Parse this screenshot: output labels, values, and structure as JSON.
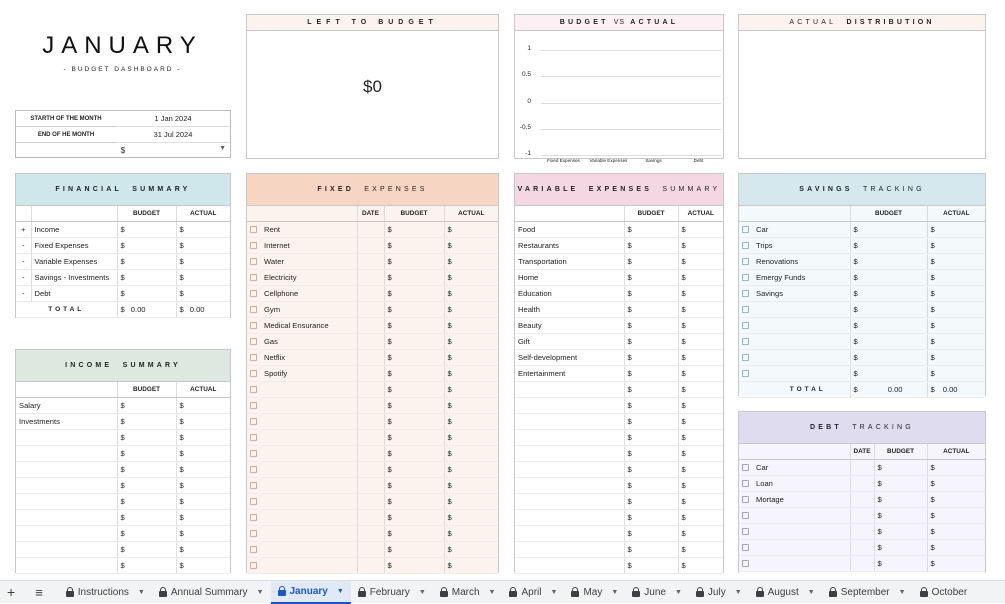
{
  "title": "JANUARY",
  "subtitle": "- BUDGET DASHBOARD -",
  "period": {
    "start_label": "STARTH OF THE MONTH",
    "start_value": "1 Jan 2024",
    "end_label": "END OF HE MONTH",
    "end_value": "31 Jul 2024",
    "currency": "$"
  },
  "left_to_budget": {
    "title": "LEFT TO BUDGET",
    "value": "$0"
  },
  "budget_vs_actual": {
    "title_a": "BUDGET",
    "title_b": "VS",
    "title_c": "ACTUAL"
  },
  "actual_distribution": {
    "title_a": "ACTUAL",
    "title_b": "DISTRIBUTION"
  },
  "chart_data": {
    "type": "bar",
    "categories": [
      "Fixed Expenses",
      "Variable Expenses",
      "Savings",
      "Debt"
    ],
    "series": [
      {
        "values": [
          0,
          0,
          0,
          0
        ]
      },
      {
        "values": [
          0,
          0,
          0,
          0
        ]
      }
    ],
    "yticks": [
      "1",
      "0.5",
      "0",
      "-0.5",
      "-1"
    ],
    "ylim": [
      -1,
      1
    ],
    "grid": true
  },
  "colors": {
    "financial": "#cfe6ea",
    "income": "#dde9e0",
    "fixed": "#f6d6c2",
    "fixed_row": "#fdf3ee",
    "variable": "#f3d7e2",
    "savings": "#d4e8ee",
    "debt": "#e0dcf0",
    "period": "#e7e4f5",
    "active_tab": "#1a56c5"
  },
  "financial_summary": {
    "title_a": "FINANCIAL",
    "title_b": "SUMMARY",
    "col_budget": "BUDGET",
    "col_actual": "ACTUAL",
    "rows": [
      {
        "sign": "+",
        "label": "Income",
        "b": "$",
        "a": "$"
      },
      {
        "sign": "-",
        "label": "Fixed Expenses",
        "b": "$",
        "a": "$"
      },
      {
        "sign": "-",
        "label": "Variable Expenses",
        "b": "$",
        "a": "$"
      },
      {
        "sign": "-",
        "label": "Savings - Investments",
        "b": "$",
        "a": "$"
      },
      {
        "sign": "-",
        "label": "Debt",
        "b": "$",
        "a": "$"
      }
    ],
    "total_label": "TOTAL",
    "total_b_cur": "$",
    "total_b": "0.00",
    "total_a_cur": "$",
    "total_a": "0.00"
  },
  "income_summary": {
    "title_a": "INCOME",
    "title_b": "SUMMARY",
    "col_budget": "BUDGET",
    "col_actual": "ACTUAL",
    "rows": [
      {
        "label": "Salary",
        "b": "$",
        "a": "$"
      },
      {
        "label": "Investments",
        "b": "$",
        "a": "$"
      },
      {
        "label": "",
        "b": "$",
        "a": "$"
      },
      {
        "label": "",
        "b": "$",
        "a": "$"
      },
      {
        "label": "",
        "b": "$",
        "a": "$"
      },
      {
        "label": "",
        "b": "$",
        "a": "$"
      },
      {
        "label": "",
        "b": "$",
        "a": "$"
      },
      {
        "label": "",
        "b": "$",
        "a": "$"
      },
      {
        "label": "",
        "b": "$",
        "a": "$"
      },
      {
        "label": "",
        "b": "$",
        "a": "$"
      },
      {
        "label": "",
        "b": "$",
        "a": "$"
      }
    ]
  },
  "fixed_expenses": {
    "title_a": "FIXED",
    "title_b": "EXPENSES",
    "col_date": "DATE",
    "col_budget": "BUDGET",
    "col_actual": "ACTUAL",
    "rows": [
      {
        "label": "Rent",
        "b": "$",
        "a": "$"
      },
      {
        "label": "Internet",
        "b": "$",
        "a": "$"
      },
      {
        "label": "Water",
        "b": "$",
        "a": "$"
      },
      {
        "label": "Electricity",
        "b": "$",
        "a": "$"
      },
      {
        "label": "Cellphone",
        "b": "$",
        "a": "$"
      },
      {
        "label": "Gym",
        "b": "$",
        "a": "$"
      },
      {
        "label": "Medical Ensurance",
        "b": "$",
        "a": "$"
      },
      {
        "label": "Gas",
        "b": "$",
        "a": "$"
      },
      {
        "label": "Netflix",
        "b": "$",
        "a": "$"
      },
      {
        "label": "Spotify",
        "b": "$",
        "a": "$"
      },
      {
        "label": "",
        "b": "$",
        "a": "$"
      },
      {
        "label": "",
        "b": "$",
        "a": "$"
      },
      {
        "label": "",
        "b": "$",
        "a": "$"
      },
      {
        "label": "",
        "b": "$",
        "a": "$"
      },
      {
        "label": "",
        "b": "$",
        "a": "$"
      },
      {
        "label": "",
        "b": "$",
        "a": "$"
      },
      {
        "label": "",
        "b": "$",
        "a": "$"
      },
      {
        "label": "",
        "b": "$",
        "a": "$"
      },
      {
        "label": "",
        "b": "$",
        "a": "$"
      },
      {
        "label": "",
        "b": "$",
        "a": "$"
      },
      {
        "label": "",
        "b": "$",
        "a": "$"
      },
      {
        "label": "",
        "b": "$",
        "a": "$"
      }
    ]
  },
  "variable_expenses": {
    "title_a": "VARIABLE",
    "title_b": "EXPENSES",
    "title_c": "SUMMARY",
    "col_budget": "BUDGET",
    "col_actual": "ACTUAL",
    "rows": [
      {
        "label": "Food",
        "b": "$",
        "a": "$"
      },
      {
        "label": "Restaurants",
        "b": "$",
        "a": "$"
      },
      {
        "label": "Transportation",
        "b": "$",
        "a": "$"
      },
      {
        "label": "Home",
        "b": "$",
        "a": "$"
      },
      {
        "label": "Education",
        "b": "$",
        "a": "$"
      },
      {
        "label": "Health",
        "b": "$",
        "a": "$"
      },
      {
        "label": "Beauty",
        "b": "$",
        "a": "$"
      },
      {
        "label": "Gift",
        "b": "$",
        "a": "$"
      },
      {
        "label": "Self-development",
        "b": "$",
        "a": "$"
      },
      {
        "label": "Entertainment",
        "b": "$",
        "a": "$"
      },
      {
        "label": "",
        "b": "$",
        "a": "$"
      },
      {
        "label": "",
        "b": "$",
        "a": "$"
      },
      {
        "label": "",
        "b": "$",
        "a": "$"
      },
      {
        "label": "",
        "b": "$",
        "a": "$"
      },
      {
        "label": "",
        "b": "$",
        "a": "$"
      },
      {
        "label": "",
        "b": "$",
        "a": "$"
      },
      {
        "label": "",
        "b": "$",
        "a": "$"
      },
      {
        "label": "",
        "b": "$",
        "a": "$"
      },
      {
        "label": "",
        "b": "$",
        "a": "$"
      },
      {
        "label": "",
        "b": "$",
        "a": "$"
      },
      {
        "label": "",
        "b": "$",
        "a": "$"
      },
      {
        "label": "",
        "b": "$",
        "a": "$"
      }
    ]
  },
  "savings_tracking": {
    "title_a": "SAVINGS",
    "title_b": "TRACKING",
    "col_budget": "BUDGET",
    "col_actual": "ACTUAL",
    "rows": [
      {
        "label": "Car",
        "b": "$",
        "a": "$"
      },
      {
        "label": "Trips",
        "b": "$",
        "a": "$"
      },
      {
        "label": "Renovations",
        "b": "$",
        "a": "$"
      },
      {
        "label": "Emergy Funds",
        "b": "$",
        "a": "$"
      },
      {
        "label": "Savings",
        "b": "$",
        "a": "$"
      },
      {
        "label": "",
        "b": "$",
        "a": "$"
      },
      {
        "label": "",
        "b": "$",
        "a": "$"
      },
      {
        "label": "",
        "b": "$",
        "a": "$"
      },
      {
        "label": "",
        "b": "$",
        "a": "$"
      },
      {
        "label": "",
        "b": "$",
        "a": "$"
      }
    ],
    "total_label": "TOTAL",
    "total_b_cur": "$",
    "total_b": "0.00",
    "total_a_cur": "$",
    "total_a": "0.00"
  },
  "debt_tracking": {
    "title_a": "DEBT",
    "title_b": "TRACKING",
    "col_date": "DATE",
    "col_budget": "BUDGET",
    "col_actual": "ACTUAL",
    "rows": [
      {
        "label": "Car",
        "b": "$",
        "a": "$"
      },
      {
        "label": "Loan",
        "b": "$",
        "a": "$"
      },
      {
        "label": "Mortage",
        "b": "$",
        "a": "$"
      },
      {
        "label": "",
        "b": "$",
        "a": "$"
      },
      {
        "label": "",
        "b": "$",
        "a": "$"
      },
      {
        "label": "",
        "b": "$",
        "a": "$"
      },
      {
        "label": "",
        "b": "$",
        "a": "$"
      }
    ]
  },
  "sheet_tabs": {
    "add_icon": "+",
    "menu_icon": "≡",
    "items": [
      {
        "label": "Instructions",
        "active": false
      },
      {
        "label": "Annual Summary",
        "active": false
      },
      {
        "label": "January",
        "active": true
      },
      {
        "label": "February",
        "active": false
      },
      {
        "label": "March",
        "active": false
      },
      {
        "label": "April",
        "active": false
      },
      {
        "label": "May",
        "active": false
      },
      {
        "label": "June",
        "active": false
      },
      {
        "label": "July",
        "active": false
      },
      {
        "label": "August",
        "active": false
      },
      {
        "label": "September",
        "active": false
      },
      {
        "label": "October",
        "active": false
      }
    ]
  }
}
